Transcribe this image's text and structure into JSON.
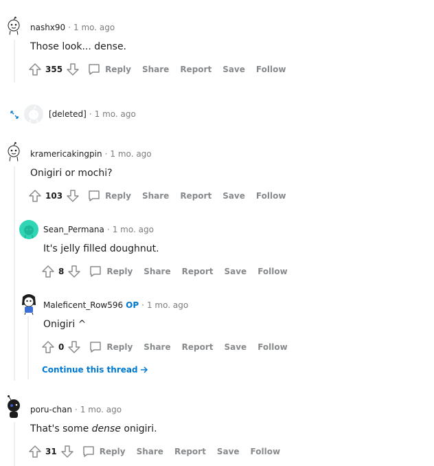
{
  "comments": [
    {
      "author": "nashx90",
      "time": "1 mo. ago",
      "body": "Those look... dense.",
      "score": "355"
    },
    {
      "author": "[deleted]",
      "time": "1 mo. ago"
    },
    {
      "author": "kramericakingpin",
      "time": "1 mo. ago",
      "body": "Onigiri or mochi?",
      "score": "103"
    },
    {
      "author": "Sean_Permana",
      "time": "1 mo. ago",
      "body": "It's jelly filled doughnut.",
      "score": "8"
    },
    {
      "author": "Maleficent_Row596",
      "op": "OP",
      "time": "1 mo. ago",
      "body": "Onigiri ^",
      "score": "0"
    },
    {
      "author": "poru-chan",
      "time": "1 mo. ago",
      "body_before": "That's some ",
      "body_em": "dense",
      "body_after": " onigiri.",
      "score": "31"
    }
  ],
  "separator": "·",
  "actions": {
    "reply": "Reply",
    "share": "Share",
    "report": "Report",
    "save": "Save",
    "follow": "Follow"
  },
  "continue_thread": "Continue this thread",
  "colors": {
    "link": "#0079d3",
    "meta": "#7c7c7c",
    "action": "#878a8c",
    "avatar_teal": "#2fd6b5"
  }
}
